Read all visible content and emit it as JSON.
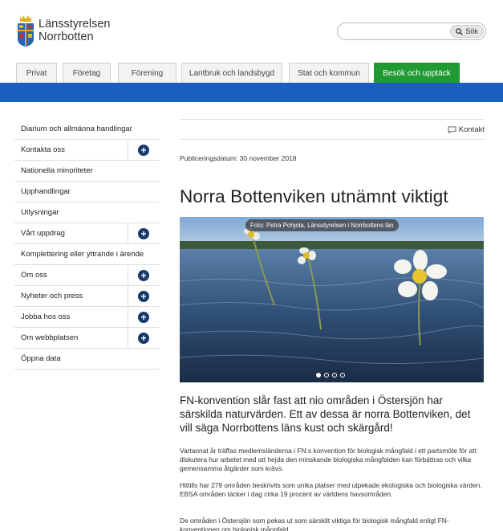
{
  "header": {
    "logo_line1": "Länsstyrelsen",
    "logo_line2": "Norrbotten",
    "search_placeholder": "",
    "search_button": "Sök"
  },
  "nav": {
    "tabs": [
      {
        "label": "Privat"
      },
      {
        "label": "Företag"
      },
      {
        "label": "Förening"
      },
      {
        "label": "Lantbruk och landsbygd"
      },
      {
        "label": "Stat och kommun"
      },
      {
        "label": "Besök och upptäck"
      }
    ],
    "active_color": "#1f9b31",
    "bar_color": "#1a5ec2"
  },
  "sidebar": {
    "items": [
      {
        "label": "Diarium och allmänna handlingar",
        "expandable": false
      },
      {
        "label": "Kontakta oss",
        "expandable": true
      },
      {
        "label": "Nationella minoriteter",
        "expandable": false
      },
      {
        "label": "Upphandlingar",
        "expandable": false
      },
      {
        "label": "Utlysningar",
        "expandable": false
      },
      {
        "label": "Vårt uppdrag",
        "expandable": true
      },
      {
        "label": "Komplettering eller yttrande i ärende",
        "expandable": false
      },
      {
        "label": "Om oss",
        "expandable": true
      },
      {
        "label": "Nyheter och press",
        "expandable": true
      },
      {
        "label": "Jobba hos oss",
        "expandable": true
      },
      {
        "label": "Om webbplatsen",
        "expandable": true
      },
      {
        "label": "Öppna data",
        "expandable": false
      }
    ],
    "plus_icon": "+"
  },
  "article": {
    "contact_link": "Kontakt",
    "pubdate": "Publiceringsdatum: 30 november 2018",
    "title": "Norra Bottenviken utnämnt viktigt",
    "photo_caption": "Foto: Petra Pohjola, Länsstyrelsen i Norrbottens län",
    "slide_count": 4,
    "active_slide": 1,
    "lead": "FN-konvention slår fast att nio områden i Östersjön har särskilda naturvärden. Ett av dessa är norra Bottenviken, det vill säga Norrbottens läns kust och skärgård!",
    "paragraphs": [
      "Vartannat år träffas medlemsländerna i FN:s konvention för biologisk mångfald i ett partsmöte för att diskutera hur arbetet med att hejda den minskande biologiska mångfalden kan förbättras och vilka gemensamma åtgärder som krävs.",
      "Hittills har 279 områden beskrivits som unika platser med utpekade ekologiska och biologiska värden. EBSA områden täcker i dag cirka 19 procent av världens havsområden.",
      "De områden i Östersjön som pekas ut som särskilt viktiga för biologisk mångfald enligt FN-konventionen om biologisk mångfald"
    ]
  }
}
